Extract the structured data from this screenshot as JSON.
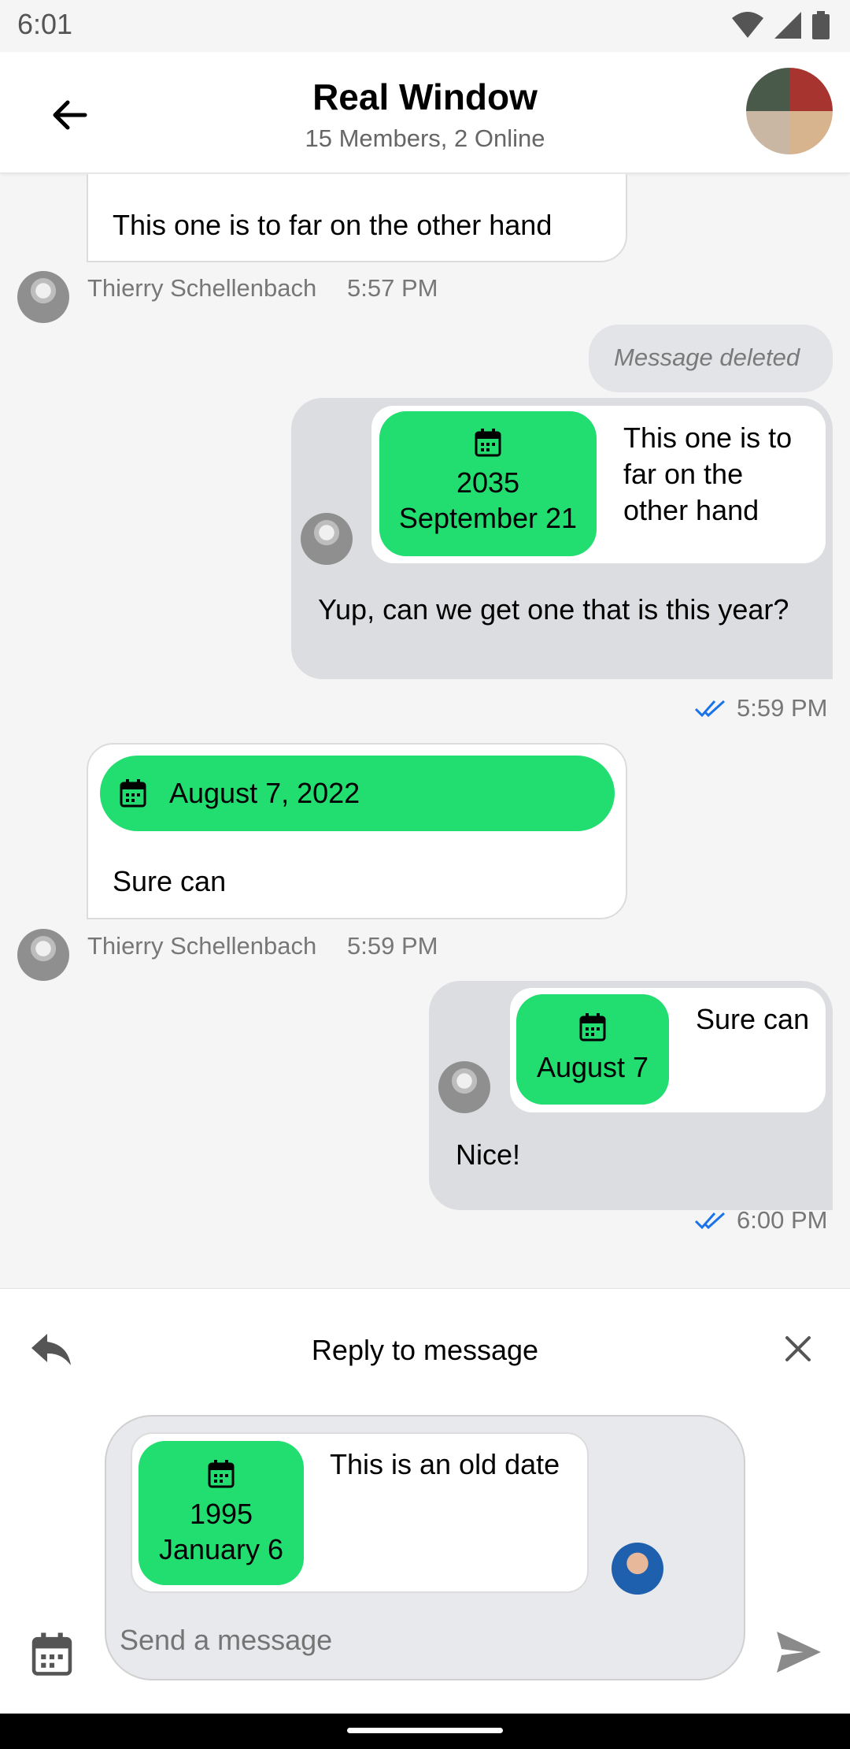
{
  "status_bar": {
    "time": "6:01"
  },
  "header": {
    "title": "Real Window",
    "subtitle": "15 Members, 2 Online"
  },
  "messages": {
    "m1": {
      "text": "This one is to far on the other hand",
      "author": "Thierry Schellenbach",
      "time": "5:57 PM"
    },
    "m2": {
      "text": "Message deleted"
    },
    "m3": {
      "quote_date_year": "2035",
      "quote_date_day": "September 21",
      "quote_text": "This one is to far on the other hand",
      "text": "Yup, can we get one that is this year?",
      "time": "5:59 PM"
    },
    "m4": {
      "date": "August 7, 2022",
      "text": "Sure can",
      "author": "Thierry Schellenbach",
      "time": "5:59 PM"
    },
    "m5": {
      "quote_date": "August 7",
      "quote_text": "Sure can",
      "text": "Nice!",
      "time": "6:00 PM"
    }
  },
  "reply": {
    "title": "Reply to message",
    "quote_date_year": "1995",
    "quote_date_day": "January 6",
    "quote_text": "This is an old date",
    "placeholder": "Send a message"
  },
  "colors": {
    "accent_green": "#22dd70",
    "read_ticks": "#1a73e8",
    "bubble_out": "#dcdde0"
  }
}
